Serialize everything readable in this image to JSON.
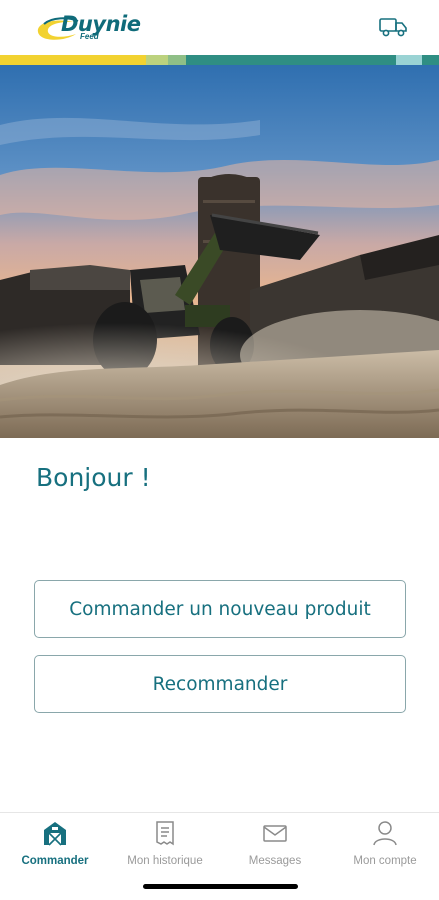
{
  "header": {
    "logo_text": "Duynie",
    "logo_sub": "Feed",
    "truck_icon": "truck-icon"
  },
  "colors": {
    "brand": "#17707f",
    "brand_yellow": "#f2d230",
    "stripe": [
      "#f2d230",
      "#f2d230",
      "#f2d230",
      "#bcd27e",
      "#8fbf87",
      "#2f8e83",
      "#2f8e83",
      "#2f8e83",
      "#2f8e83",
      "#9ad3d4",
      "#2f8e83"
    ]
  },
  "main": {
    "greeting": "Bonjour !",
    "order_new_label": "Commander un nouveau produit",
    "reorder_label": "Recommander"
  },
  "nav": {
    "items": [
      {
        "label": "Commander",
        "icon": "barn-icon",
        "active": true
      },
      {
        "label": "Mon historique",
        "icon": "receipt-icon",
        "active": false
      },
      {
        "label": "Messages",
        "icon": "envelope-icon",
        "active": false
      },
      {
        "label": "Mon compte",
        "icon": "user-icon",
        "active": false
      }
    ]
  }
}
